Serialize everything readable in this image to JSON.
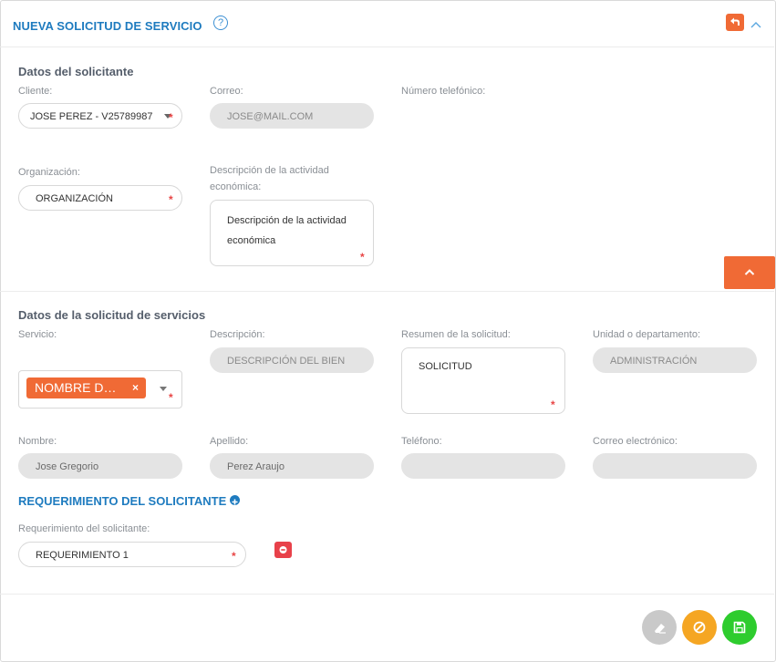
{
  "header": {
    "title": "NUEVA SOLICITUD DE SERVICIO",
    "help_glyph": "?",
    "icons": [
      "help-icon",
      "undo-icon",
      "chevron-up-icon"
    ],
    "accent": "#f06a35",
    "title_color": "#1e7bbf"
  },
  "solicitante": {
    "section_title": "Datos del solicitante",
    "cliente_label": "Cliente:",
    "cliente_value": "JOSE PEREZ - V25789987",
    "correo_label": "Correo:",
    "correo_value": "JOSE@MAIL.COM",
    "telefono_label": "Número telefónico:",
    "organizacion_label": "Organización:",
    "organizacion_value": "ORGANIZACIÓN",
    "actividad_label": "Descripción de la actividad económica:",
    "actividad_value": "Descripción de la actividad económica"
  },
  "servicios": {
    "section_title": "Datos de la solicitud de servicios",
    "servicio_label": "Servicio:",
    "servicio_chip": "NOMBRE D…",
    "chip_remove": "×",
    "descripcion_label": "Descripción:",
    "descripcion_value": "DESCRIPCIÓN DEL BIEN",
    "resumen_label": "Resumen de la solicitud:",
    "resumen_value": "SOLICITUD",
    "unidad_label": "Unidad o departamento:",
    "unidad_value": "ADMINISTRACIÓN",
    "nombre_label": "Nombre:",
    "nombre_value": "Jose Gregorio",
    "apellido_label": "Apellido:",
    "apellido_value": "Perez Araujo",
    "telefono_label": "Teléfono:",
    "telefono_value": "",
    "email_label": "Correo electrónico:",
    "email_value": ""
  },
  "requerimiento": {
    "section_title": "REQUERIMIENTO DEL SOLICITANTE",
    "field_label": "Requerimiento del solicitante:",
    "field_value": "REQUERIMIENTO 1"
  },
  "required_mark": "*",
  "actions": {
    "icons": [
      "eraser-icon",
      "cancel-icon",
      "save-icon"
    ],
    "colors": {
      "clear": "#c9c9c9",
      "cancel": "#f5a623",
      "save": "#2ecc2e"
    }
  }
}
